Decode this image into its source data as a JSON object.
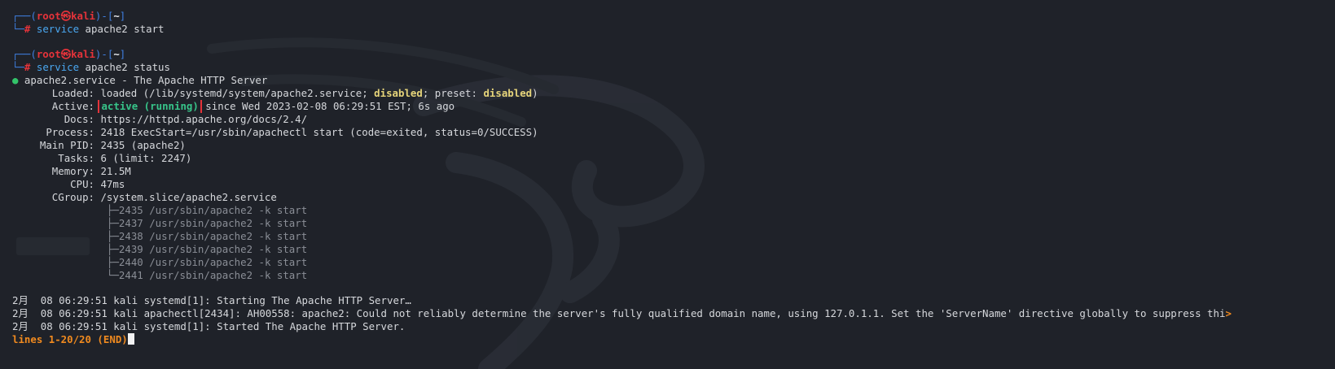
{
  "prompt": {
    "user": "root",
    "at_symbol": "㉿",
    "host": "kali",
    "cwd": "~",
    "symbol": "#",
    "corner_top": "┌──(",
    "corner_mid": ")-[",
    "corner_end": "]",
    "corner_bottom": "└─"
  },
  "commands": [
    {
      "cmd": "service",
      "args": " apache2 start"
    },
    {
      "cmd": "service",
      "args": " apache2 status"
    }
  ],
  "status": {
    "dot": "●",
    "header": " apache2.service - The Apache HTTP Server",
    "loaded_label": "Loaded:",
    "loaded_value_a": " loaded (/lib/systemd/system/apache2.service; ",
    "loaded_disabled": "disabled",
    "loaded_value_b": "; preset: ",
    "loaded_preset": "disabled",
    "loaded_value_c": ")",
    "active_label": "Active:",
    "active_state": "active (running)",
    "active_since": " since Wed 2023-02-08 06:29:51 EST; 6s ago",
    "docs_label": "Docs:",
    "docs_value": " https://httpd.apache.org/docs/2.4/",
    "process_label": "Process:",
    "process_value": " 2418 ExecStart=/usr/sbin/apachectl start (code=exited, status=0/SUCCESS)",
    "pid_label": "Main PID:",
    "pid_value": " 2435 (apache2)",
    "tasks_label": "Tasks:",
    "tasks_value": " 6 (limit: 2247)",
    "memory_label": "Memory:",
    "memory_value": " 21.5M",
    "cpu_label": "CPU:",
    "cpu_value": " 47ms",
    "cgroup_label": "CGroup:",
    "cgroup_value": " /system.slice/apache2.service",
    "cgroup_tree": [
      {
        "branch": "├─",
        "text": "2435 /usr/sbin/apache2 -k start"
      },
      {
        "branch": "├─",
        "text": "2437 /usr/sbin/apache2 -k start"
      },
      {
        "branch": "├─",
        "text": "2438 /usr/sbin/apache2 -k start"
      },
      {
        "branch": "├─",
        "text": "2439 /usr/sbin/apache2 -k start"
      },
      {
        "branch": "├─",
        "text": "2440 /usr/sbin/apache2 -k start"
      },
      {
        "branch": "└─",
        "text": "2441 /usr/sbin/apache2 -k start"
      }
    ]
  },
  "logs": [
    "2月  08 06:29:51 kali systemd[1]: Starting The Apache HTTP Server…",
    "2月  08 06:29:51 kali apachectl[2434]: AH00558: apache2: Could not reliably determine the server's fully qualified domain name, using 127.0.1.1. Set the 'ServerName' directive globally to suppress thi",
    "2月  08 06:29:51 kali systemd[1]: Started The Apache HTTP Server."
  ],
  "log_truncation_marker": ">",
  "pager": {
    "status": "lines 1-20/20 (END)"
  },
  "colors": {
    "background": "#1f2229",
    "prompt_frame": "#3f7fe0",
    "prompt_user": "#e5333a",
    "command": "#4aa7f0",
    "status_ok": "#37c58a",
    "disabled_text": "#e6d47a",
    "pager": "#f08a1f",
    "highlight_box": "#e5333a"
  }
}
